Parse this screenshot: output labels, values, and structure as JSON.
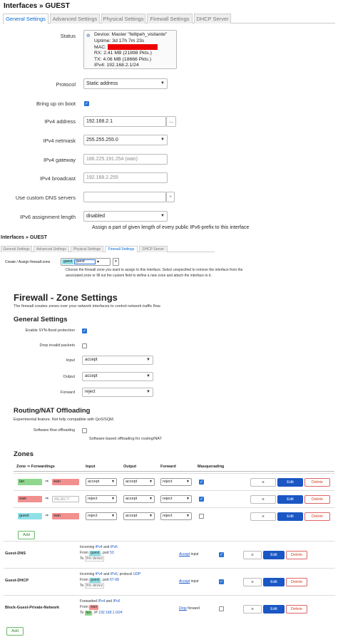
{
  "top": {
    "title": "Interfaces » GUEST",
    "tabs": [
      "General Settings",
      "Advanced Settings",
      "Physical Settings",
      "Firewall Settings",
      "DHCP Server"
    ],
    "status_label": "Status",
    "status": {
      "device": "Device: Master \"fellipeh_visitante\"",
      "uptime": "Uptime: 3d 17h 7m 23s",
      "mac": "MAC:",
      "rx": "RX: 2.41 MB (21898 Pkts.)",
      "tx": "TX: 4.06 MB (18666 Pkts.)",
      "ipv4": "IPv4: 192.168.2.1/24"
    },
    "protocol_label": "Protocol",
    "protocol_value": "Static address",
    "bringup_label": "Bring up on boot",
    "ipv4addr_label": "IPv4 address",
    "ipv4addr_value": "192.168.2.1",
    "ipv4addr_btn": "...",
    "netmask_label": "IPv4 netmask",
    "netmask_value": "255.255.255.0",
    "gateway_label": "IPv4 gateway",
    "gateway_placeholder": "186.225.191.254 (wan)",
    "broadcast_label": "IPv4 broadcast",
    "broadcast_placeholder": "192.168.2.255",
    "dns_label": "Use custom DNS servers",
    "dns_add": "+",
    "ipv6_label": "IPv6 assignment length",
    "ipv6_value": "disabled",
    "ipv6_hint": "Assign a part of given length of every public IPv6-prefix to this interface"
  },
  "mid": {
    "title": "Interfaces » GUEST",
    "tabs": [
      "General Settings",
      "Advanced Settings",
      "Physical Settings",
      "Firewall Settings",
      "DHCP Server"
    ],
    "zone_label": "Create / Assign firewall-zone",
    "zone_badge": "guest",
    "zone_input": "guest:",
    "zone_hint1": "Choose the firewall zone you want to assign to this interface. Select unspecified to remove the interface from the",
    "zone_hint2": "associated zone or fill out the custom field to define a new zone and attach the interface to it."
  },
  "fw": {
    "title": "Firewall - Zone Settings",
    "subtitle": "The firewall creates zones over your network interfaces to control network traffic flow.",
    "general_title": "General Settings",
    "synflood_label": "Enable SYN-flood protection",
    "dropinvalid_label": "Drop invalid packets",
    "input_label": "Input",
    "input_value": "accept",
    "output_label": "Output",
    "output_value": "accept",
    "forward_label": "Forward",
    "forward_value": "reject",
    "routing_title": "Routing/NAT Offloading",
    "routing_desc": "Experimental feature. Not fully compatible with QoS/SQM.",
    "swoffload_label": "Software flow offloading",
    "swoffload_hint": "Software based offloading for routing/NAT",
    "zones_title": "Zones",
    "headers": [
      "Zone ⇒ Forwardings",
      "Input",
      "Output",
      "Forward",
      "Masquerading"
    ],
    "zones": [
      {
        "name": "lan",
        "fwd": "wan",
        "input": "accept",
        "output": "accept",
        "forward": "reject",
        "masq": true
      },
      {
        "name": "wan",
        "fwd": "REJECT",
        "input": "reject",
        "output": "accept",
        "forward": "reject",
        "masq": true
      },
      {
        "name": "guest",
        "fwd": "wan",
        "input": "reject",
        "output": "accept",
        "forward": "reject",
        "masq": false
      }
    ],
    "arrow": "⇒",
    "menu_btn": "≡",
    "edit_btn": "Edit",
    "delete_btn": "Delete",
    "add_btn": "Add",
    "colors": {
      "lan": "#90d890",
      "wan": "#f29090",
      "guest": "#90e0e8",
      "edit": "#1a56c4"
    }
  },
  "rules": [
    {
      "name": "Guest-DNS",
      "l1a": "Incoming ",
      "l1b": "IPv4",
      " l1c": "",
      "l1mid": " and ",
      "l1d": "IPv6",
      "l2a": "From ",
      "l2tag": "guest",
      "l2b": ", port ",
      "l2c": "53",
      "l3a": "To ",
      "l3b": "this device",
      "action": "Accept",
      "action_tail": " input",
      "enabled": true
    },
    {
      "name": "Guest-DHCP",
      "l1a": "Incoming ",
      "l1b": "IPv4",
      "l1mid": " and ",
      "l1d": "IPv6",
      "l1e": ", protocol ",
      "l1f": "UDP",
      "l2a": "From ",
      "l2tag": "guest",
      "l2b": ", port ",
      "l2c": "67-68",
      "l3a": "To ",
      "l3b": "this device",
      "action": "Accept",
      "action_tail": " input",
      "enabled": true
    },
    {
      "name": "Block-Guest-Private-Network",
      "l1a": "Forwarded ",
      "l1b": "IPv4",
      "l1mid": " and ",
      "l1d": "IPv6",
      "l2a": "From ",
      "l2tag": "wan",
      "l3a": "To ",
      "l3tag": "lan",
      "l3c": ", IP ",
      "l3d": "192.168.1.0/24",
      "action": "Drop",
      "action_tail": " forward",
      "enabled": false
    }
  ],
  "rules_add": "Add"
}
